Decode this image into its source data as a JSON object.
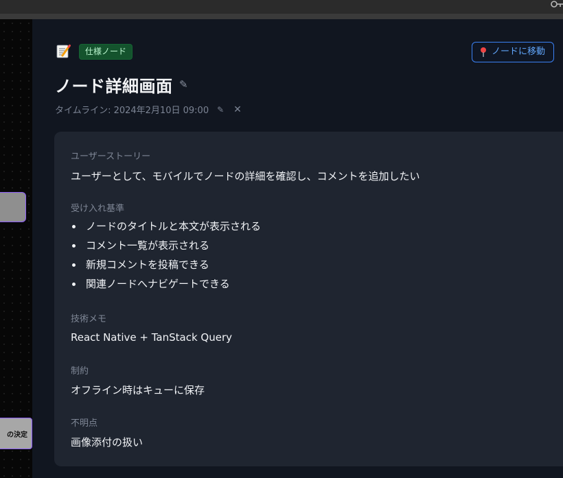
{
  "node": {
    "type_badge": "仕様ノード",
    "goto_label": "ノードに移動",
    "title": "ノード詳細画面",
    "timeline": "タイムライン: 2024年2月10日 09:00"
  },
  "canvas": {
    "node2_label": "の決定"
  },
  "sections": {
    "user_story": {
      "label": "ユーザーストーリー",
      "value": "ユーザーとして、モバイルでノードの詳細を確認し、コメントを追加したい"
    },
    "acceptance": {
      "label": "受け入れ基準",
      "items": [
        "ノードのタイトルと本文が表示される",
        "コメント一覧が表示される",
        "新規コメントを投稿できる",
        "関連ノードへナビゲートできる"
      ]
    },
    "tech_memo": {
      "label": "技術メモ",
      "value": "React Native + TanStack Query"
    },
    "constraints": {
      "label": "制約",
      "value": "オフライン時はキューに保存"
    },
    "unknowns": {
      "label": "不明点",
      "value": "画像添付の扱い"
    }
  },
  "colors": {
    "badge_bg": "#14532d",
    "accent_blue": "#3b82f6",
    "panel_bg": "#111620",
    "card_bg": "#1f2530"
  },
  "icons": {
    "memo": "memo-icon",
    "pin": "pin-icon",
    "edit": "pencil-icon",
    "close": "close-icon",
    "key": "key-icon"
  }
}
